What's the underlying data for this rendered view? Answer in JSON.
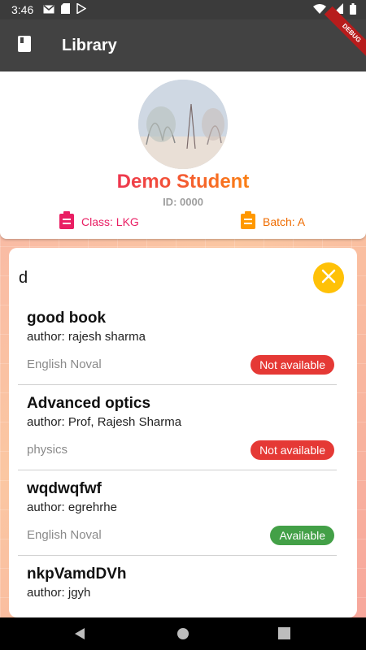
{
  "status_bar": {
    "time": "3:46",
    "icons": [
      "gmail-icon",
      "sd-card-icon",
      "play-store-icon",
      "wifi-icon",
      "signal-icon",
      "battery-icon"
    ]
  },
  "app_bar": {
    "title": "Library",
    "icon": "book-icon"
  },
  "debug_banner": "DEBUG",
  "profile": {
    "name": "Demo Student",
    "id_text": "ID: 0000",
    "class_text": "Class: LKG",
    "batch_text": "Batch: A",
    "colors": {
      "name_start": "#e91e63",
      "name_end": "#ff9800",
      "class": "#e91e63",
      "batch": "#ef6c00"
    }
  },
  "search": {
    "query": "d",
    "clear_icon": "close-icon",
    "clear_color": "#ffc107"
  },
  "books": [
    {
      "title": "good book",
      "author": "author: rajesh sharma",
      "category": "English Noval",
      "status": "Not available",
      "status_color": "#e53935"
    },
    {
      "title": "Advanced optics",
      "author": "author: Prof, Rajesh Sharma",
      "category": "physics",
      "status": "Not available",
      "status_color": "#e53935"
    },
    {
      "title": "wqdwqfwf",
      "author": "author: egrehrhe",
      "category": "English Noval",
      "status": "Available",
      "status_color": "#43a047"
    },
    {
      "title": "nkpVamdDVh",
      "author": "author: jgyh",
      "category": "",
      "status": "",
      "status_color": ""
    }
  ],
  "nav_bar": {
    "icons": [
      "back-icon",
      "home-icon",
      "recents-icon"
    ]
  }
}
